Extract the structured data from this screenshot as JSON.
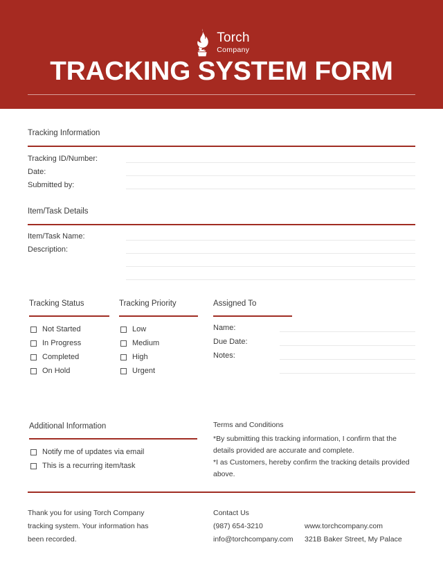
{
  "brand": {
    "logo_icon": "torch-flame-icon",
    "name": "Torch",
    "subtitle": "Company",
    "accent_color": "#a62a21",
    "rule_color": "#a02c22",
    "line_color": "#e9e9e9"
  },
  "header": {
    "title": "TRACKING SYSTEM FORM"
  },
  "sections": {
    "tracking_information": {
      "title": "Tracking Information",
      "fields": [
        {
          "label": "Tracking ID/Number:",
          "value": ""
        },
        {
          "label": "Date:",
          "value": ""
        },
        {
          "label": "Submitted by:",
          "value": ""
        }
      ]
    },
    "item_task_details": {
      "title": "Item/Task Details",
      "fields": [
        {
          "label": "Item/Task Name:",
          "value": ""
        },
        {
          "label": "Description:",
          "value": ""
        }
      ]
    },
    "tracking_status": {
      "title": "Tracking Status",
      "options": [
        "Not Started",
        "In Progress",
        "Completed",
        "On Hold"
      ]
    },
    "tracking_priority": {
      "title": "Tracking Priority",
      "options": [
        "Low",
        "Medium",
        "High",
        "Urgent"
      ]
    },
    "assigned_to": {
      "title": "Assigned To",
      "fields": [
        {
          "label": "Name:",
          "value": ""
        },
        {
          "label": "Due Date:",
          "value": ""
        },
        {
          "label": "Notes:",
          "value": ""
        }
      ]
    },
    "additional_information": {
      "title": "Additional Information",
      "options": [
        "Notify me of updates via email",
        "This is a recurring item/task"
      ]
    },
    "terms": {
      "title": "Terms and Conditions",
      "paragraph_1": "*By submitting this tracking information, I confirm that the details provided are accurate and complete.",
      "paragraph_2": "*I as Customers, hereby confirm the tracking details provided above."
    }
  },
  "footer": {
    "thanks": "Thank you for using Torch Company tracking system. Your information has been recorded.",
    "contact_title": "Contact Us",
    "phone": "(987) 654-3210",
    "email": "info@torchcompany.com",
    "website": "www.torchcompany.com",
    "address": "321B Baker Street, My Palace"
  }
}
